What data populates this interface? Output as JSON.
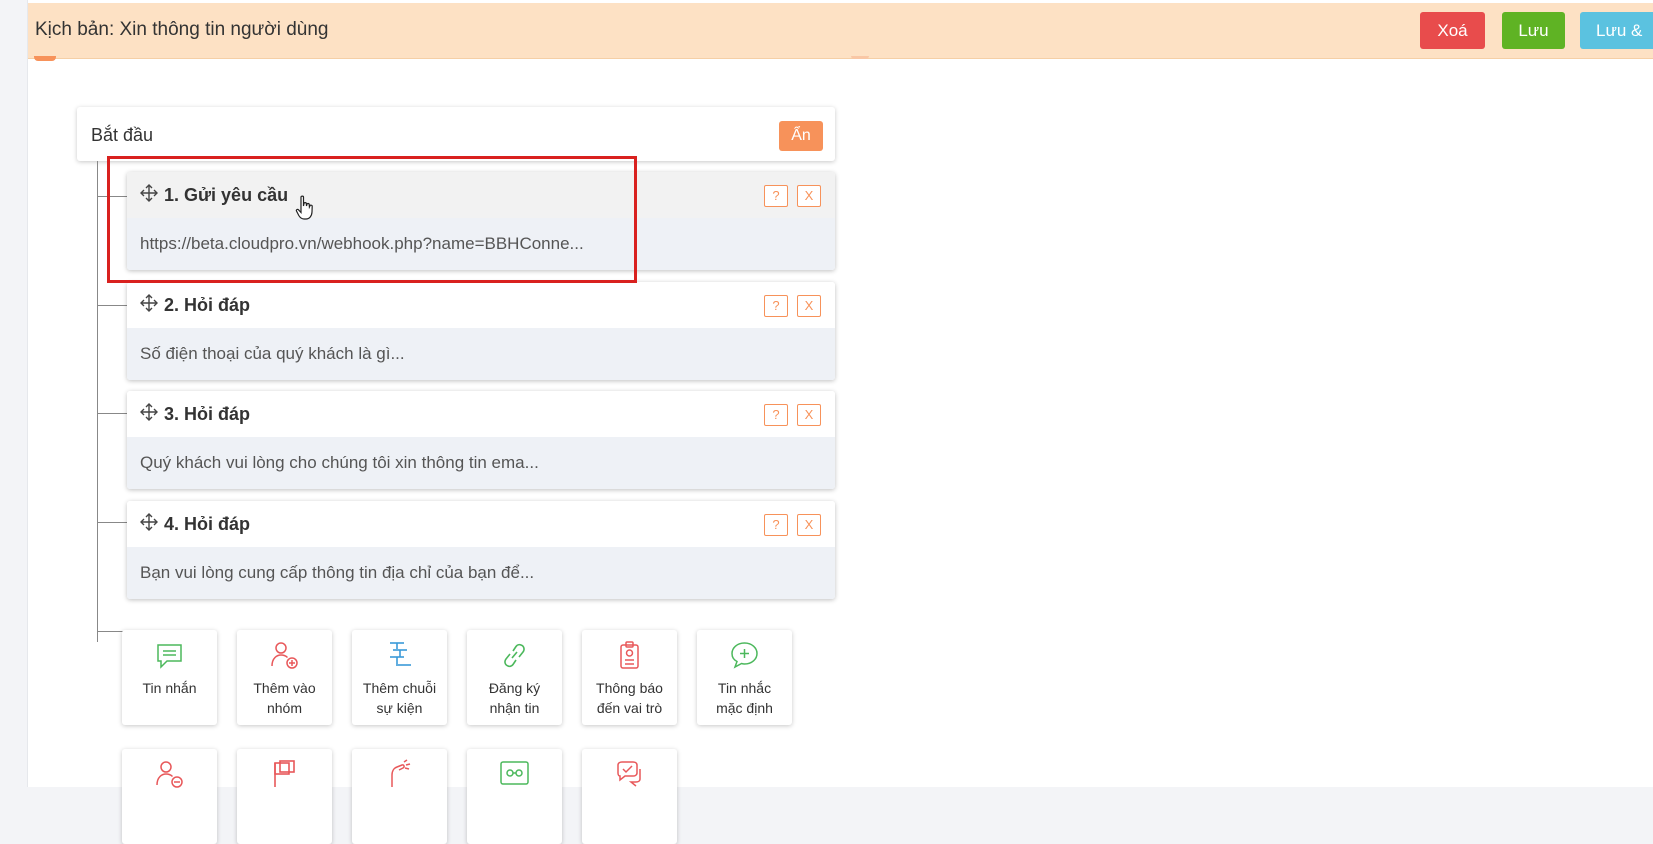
{
  "header": {
    "title": "Kịch bản: Xin thông tin người dùng",
    "delete_label": "Xoá",
    "save_label": "Lưu",
    "save_exit_label": "Lưu &"
  },
  "start": {
    "label": "Bắt đầu",
    "hide_label": "Ẩn"
  },
  "steps": [
    {
      "title": "1. Gửi yêu cầu",
      "text": "https://beta.cloudpro.vn/webhook.php?name=BBHConne...",
      "help": "?",
      "close": "X"
    },
    {
      "title": "2. Hỏi đáp",
      "text": "Số điện thoại của quý khách là gì...",
      "help": "?",
      "close": "X"
    },
    {
      "title": "3. Hỏi đáp",
      "text": "Quý khách vui lòng cho chúng tôi xin thông tin ema...",
      "help": "?",
      "close": "X"
    },
    {
      "title": "4. Hỏi đáp",
      "text": "Bạn vui lòng cung cấp thông tin địa chỉ của bạn để...",
      "help": "?",
      "close": "X"
    }
  ],
  "tiles": [
    {
      "line1": "Tin nhắn",
      "line2": "",
      "icon": "message-icon",
      "color": "#4cb85c"
    },
    {
      "line1": "Thêm vào",
      "line2": "nhóm",
      "icon": "add-user-icon",
      "color": "#e8585a"
    },
    {
      "line1": "Thêm chuỗi",
      "line2": "sự kiện",
      "icon": "sequence-icon",
      "color": "#3a9ad9"
    },
    {
      "line1": "Đăng ký",
      "line2": "nhận tin",
      "icon": "link-icon",
      "color": "#4cb85c"
    },
    {
      "line1": "Thông báo",
      "line2": "đến vai trò",
      "icon": "badge-icon",
      "color": "#e8585a"
    },
    {
      "line1": "Tin nhắc",
      "line2": "mặc định",
      "icon": "default-message-icon",
      "color": "#4cb85c"
    }
  ],
  "tiles_row2": [
    {
      "icon": "remove-user-icon",
      "color": "#e8585a"
    },
    {
      "icon": "flag-icon",
      "color": "#e8585a"
    },
    {
      "icon": "hand-icon",
      "color": "#e8585a"
    },
    {
      "icon": "connector-icon",
      "color": "#4cb85c"
    },
    {
      "icon": "chat-check-icon",
      "color": "#e8585a"
    }
  ],
  "colors": {
    "header_bg": "#fde1c4",
    "accent_orange": "#f7925a",
    "danger": "#e84c4c",
    "success": "#5fb324",
    "info": "#5bc2e0",
    "highlight": "#d9211f"
  }
}
